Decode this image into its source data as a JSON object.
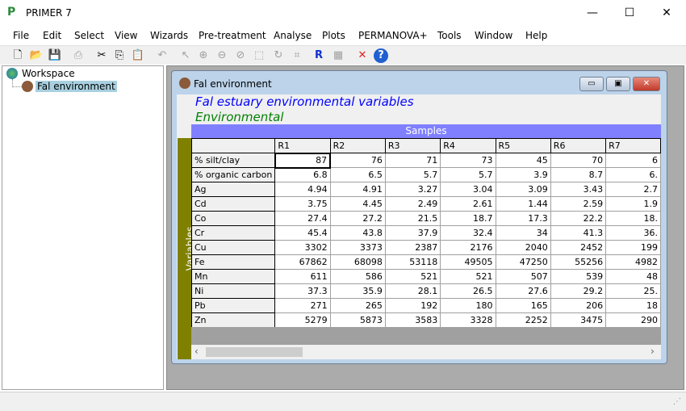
{
  "app": {
    "title": "PRIMER 7"
  },
  "menu": [
    "File",
    "Edit",
    "Select",
    "View",
    "Wizards",
    "Pre-treatment",
    "Analyse",
    "Plots",
    "PERMANOVA+",
    "Tools",
    "Window",
    "Help"
  ],
  "toolbar": [
    "new-icon",
    "open-icon",
    "save-icon",
    "print-icon",
    "cut-icon",
    "copy-icon",
    "paste-icon",
    "undo-icon",
    "pointer-icon",
    "zoom-in-icon",
    "zoom-out-icon",
    "zoom-reset-icon",
    "select-box-icon",
    "rotate-icon",
    "crop-icon",
    "rename-icon",
    "matrix-icon",
    "delete-icon",
    "help-icon"
  ],
  "tree": {
    "root": "Workspace",
    "item": "Fal environment"
  },
  "window": {
    "title": "Fal environment",
    "title1": "Fal estuary environmental variables",
    "title2": "Environmental",
    "samples_label": "Samples",
    "variables_label": "Variables"
  },
  "columns": [
    "R1",
    "R2",
    "R3",
    "R4",
    "R5",
    "R6",
    "R7"
  ],
  "rows": [
    {
      "label": "% silt/clay",
      "values": [
        "87",
        "76",
        "71",
        "73",
        "45",
        "70",
        "6"
      ]
    },
    {
      "label": "% organic carbon",
      "values": [
        "6.8",
        "6.5",
        "5.7",
        "5.7",
        "3.9",
        "8.7",
        "6."
      ]
    },
    {
      "label": "Ag",
      "values": [
        "4.94",
        "4.91",
        "3.27",
        "3.04",
        "3.09",
        "3.43",
        "2.7"
      ]
    },
    {
      "label": "Cd",
      "values": [
        "3.75",
        "4.45",
        "2.49",
        "2.61",
        "1.44",
        "2.59",
        "1.9"
      ]
    },
    {
      "label": "Co",
      "values": [
        "27.4",
        "27.2",
        "21.5",
        "18.7",
        "17.3",
        "22.2",
        "18."
      ]
    },
    {
      "label": "Cr",
      "values": [
        "45.4",
        "43.8",
        "37.9",
        "32.4",
        "34",
        "41.3",
        "36."
      ]
    },
    {
      "label": "Cu",
      "values": [
        "3302",
        "3373",
        "2387",
        "2176",
        "2040",
        "2452",
        "199"
      ]
    },
    {
      "label": "Fe",
      "values": [
        "67862",
        "68098",
        "53118",
        "49505",
        "47250",
        "55256",
        "4982"
      ]
    },
    {
      "label": "Mn",
      "values": [
        "611",
        "586",
        "521",
        "521",
        "507",
        "539",
        "48"
      ]
    },
    {
      "label": "Ni",
      "values": [
        "37.3",
        "35.9",
        "28.1",
        "26.5",
        "27.6",
        "29.2",
        "25."
      ]
    },
    {
      "label": "Pb",
      "values": [
        "271",
        "265",
        "192",
        "180",
        "165",
        "206",
        "18"
      ]
    },
    {
      "label": "Zn",
      "values": [
        "5279",
        "5873",
        "3583",
        "3328",
        "2252",
        "3475",
        "290"
      ]
    }
  ]
}
